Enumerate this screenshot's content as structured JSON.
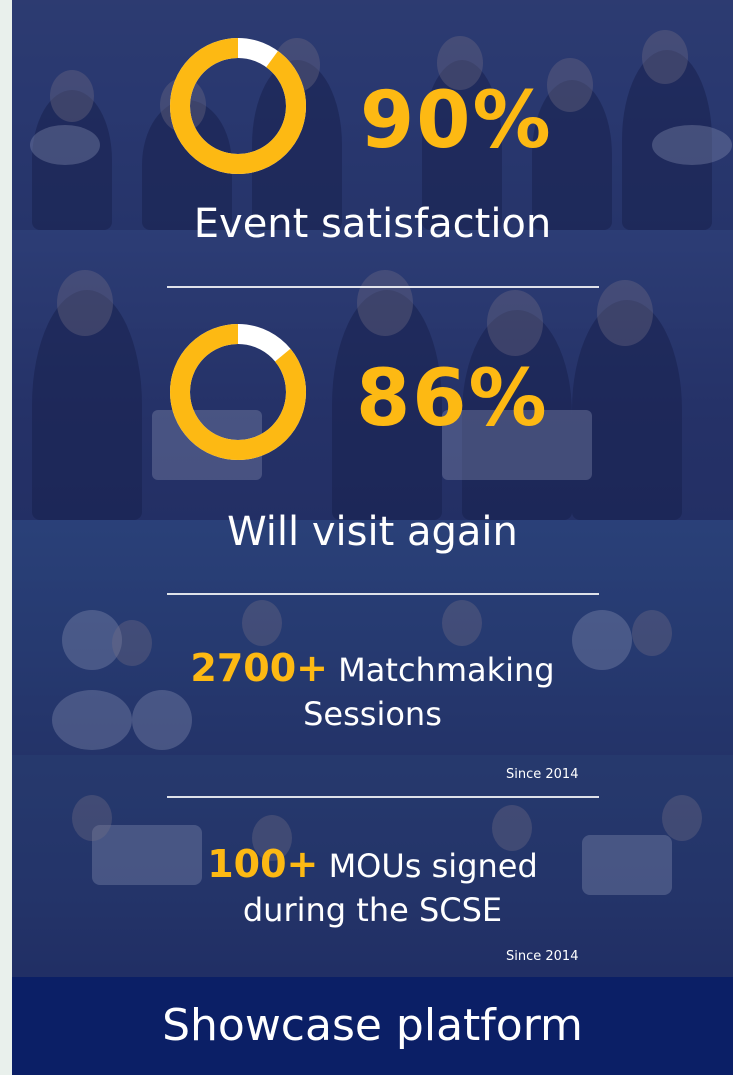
{
  "stats": [
    {
      "percent": 90,
      "value_text": "90%",
      "label": "Event satisfaction"
    },
    {
      "percent": 86,
      "value_text": "86%",
      "label": "Will visit again"
    }
  ],
  "matchmaking": {
    "number": "2700+",
    "line1": "Matchmaking",
    "line2": "Sessions",
    "since": "Since 2014"
  },
  "mous": {
    "number": "100+",
    "line1": "MOUs signed",
    "line2": "during the SCSE",
    "since": "Since 2014"
  },
  "footer": {
    "label": "Showcase platform"
  },
  "colors": {
    "accent": "#fdb913",
    "ring_remainder": "#ffffff",
    "footer_bg": "#0b1f66",
    "text": "#ffffff"
  }
}
